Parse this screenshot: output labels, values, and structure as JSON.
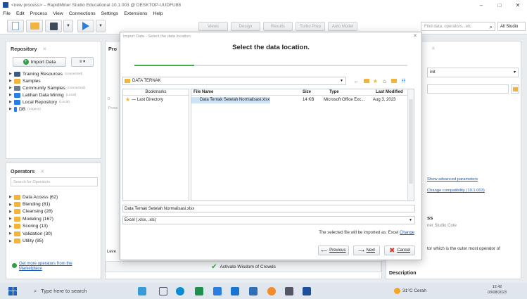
{
  "window": {
    "title": "<new process> – RapidMiner Studio Educational 10.1.003 @ DESKTOP-UUDFU88",
    "min": "–",
    "max": "□",
    "close": "✕"
  },
  "menu": [
    "File",
    "Edit",
    "Process",
    "View",
    "Connections",
    "Settings",
    "Extensions",
    "Help"
  ],
  "toolbar": {
    "view_tabs": [
      "Views",
      "Design",
      "Results",
      "Turbo Prep",
      "Auto Model"
    ],
    "search_placeholder": "Find data, operators...etc",
    "studio": "All Studio"
  },
  "repository": {
    "title": "Repository",
    "import_label": "Import Data",
    "menu_label": "≡ ▾",
    "items": [
      {
        "label": "Training Resources",
        "sub": "(connected)",
        "color": "#3d5a80"
      },
      {
        "label": "Samples",
        "sub": "",
        "color": "#f2b43c"
      },
      {
        "label": "Community Samples",
        "sub": "(connected)",
        "color": "#6c7a89"
      },
      {
        "label": "Latihan Data Mining",
        "sub": "(Local)",
        "color": "#2a7de1"
      },
      {
        "label": "Local Repository",
        "sub": "(Local)",
        "color": "#2a7de1"
      },
      {
        "label": "DB",
        "sub": "(Legacy)",
        "color": "#2a7de1"
      }
    ]
  },
  "operators": {
    "title": "Operators",
    "search_placeholder": "Search for Operators",
    "items": [
      "Data Access (62)",
      "Blending (81)",
      "Cleansing (28)",
      "Modeling (167)",
      "Scoring (13)",
      "Validation (30)",
      "Utility (85)"
    ],
    "marketplace": "Get more operators from the Marketplace"
  },
  "process": {
    "title": "Pro",
    "frag": "Proce",
    "frag2": "Ｏ",
    "level": "Leve",
    "wisdom": "Activate Wisdom of Crowds"
  },
  "params": {
    "select_value": "init",
    "advanced": "Show advanced parameters",
    "compat": "Change compatibility (10.1.003)",
    "ss": "ss",
    "core": "ner Studio Core",
    "outer": "tor which is the outer most operator of",
    "description": "Description"
  },
  "dialog": {
    "titlebar": "Import Data - Select the data location.",
    "heading": "Select the data location.",
    "progress": 0.22,
    "location": "DATA TERNAK",
    "bookmarks_header": "Bookmarks",
    "bookmark_last": "— Last Directory",
    "columns": [
      "File Name",
      "Size",
      "Type",
      "Last Modified"
    ],
    "file": {
      "name": "Data Ternak Setelah Normalisasi.xlsx",
      "size": "14 KB",
      "type": "Microsoft Office Exc...",
      "modified": "Aug 3, 2023"
    },
    "filename_field": "Data Ternak Setelah Normalisasi.xlsx",
    "filetype": "Excel (.xlsx, .xls)",
    "import_note": "The selected file will be imported as: Excel",
    "change": "Change",
    "previous": "Previous",
    "next": "Next",
    "cancel": "Cancel"
  },
  "taskbar": {
    "search": "Type here to search",
    "weather": "31°C  Cerah",
    "time": "12.42",
    "date": "03/08/2023"
  }
}
